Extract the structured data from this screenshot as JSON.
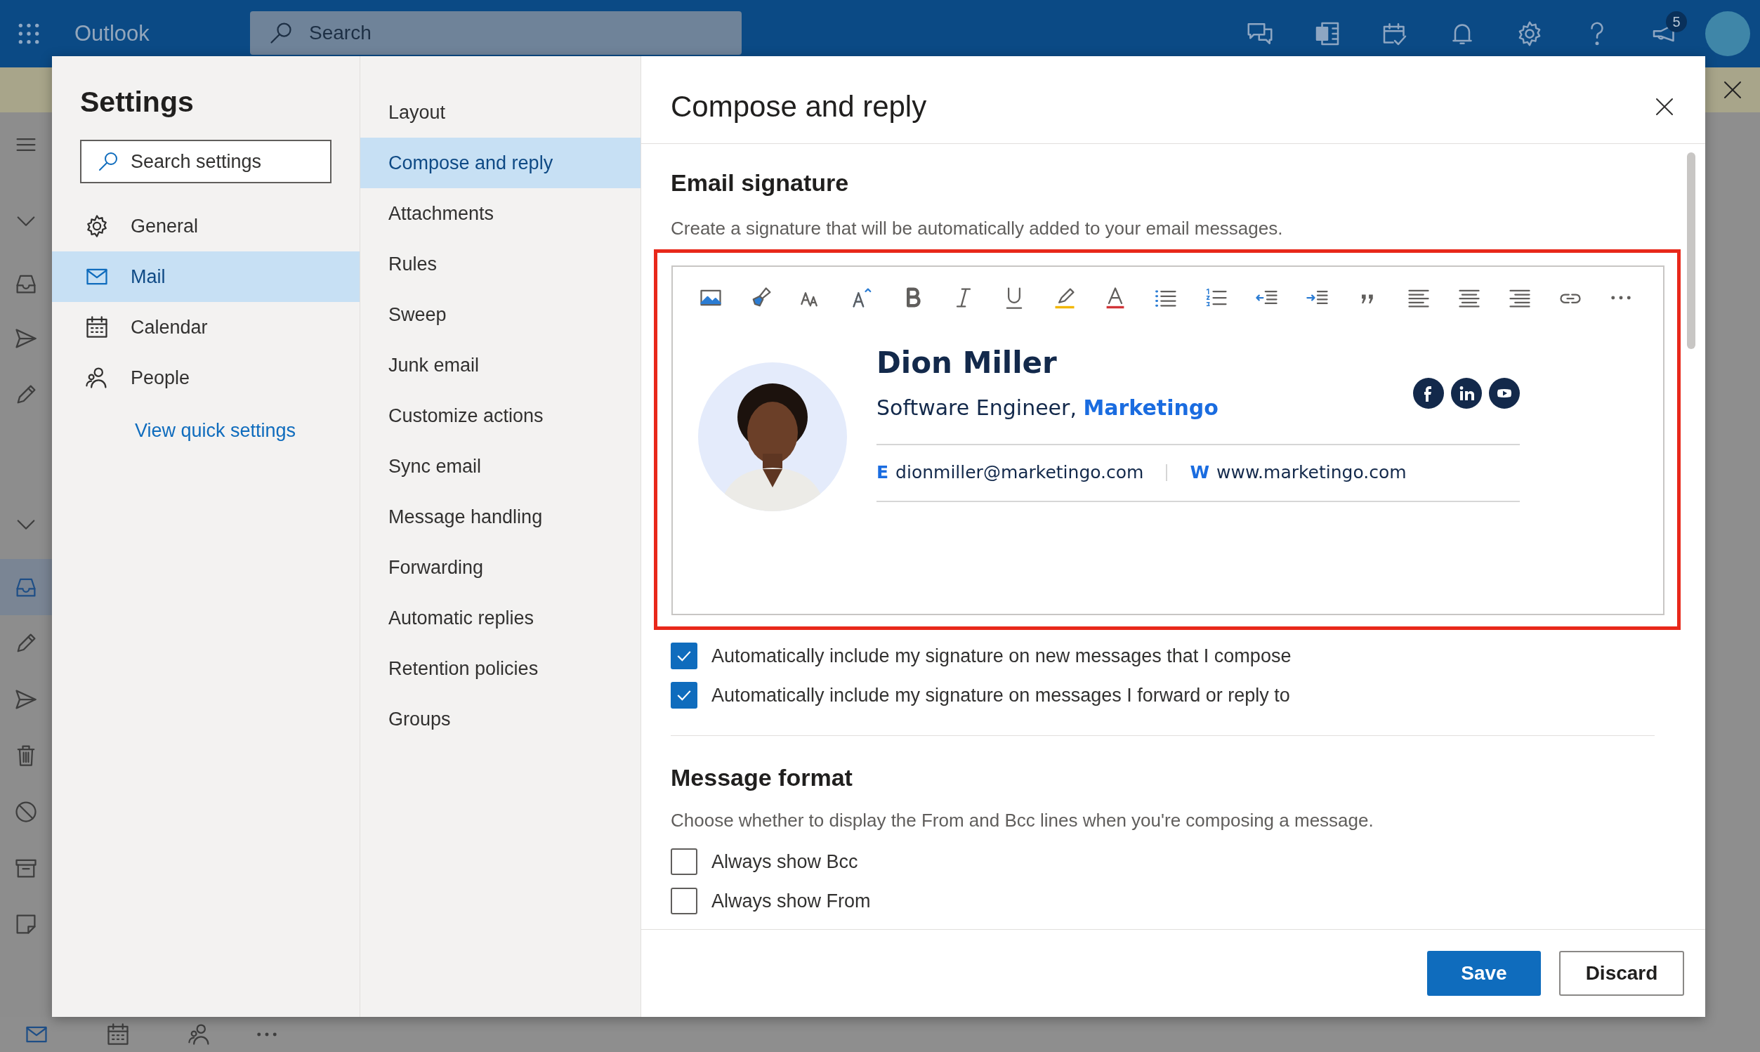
{
  "top_bar": {
    "app_name": "Outlook",
    "search": {
      "placeholder": "Search"
    },
    "notification_count": "5"
  },
  "nav_rail": [
    {
      "selected": false
    },
    {
      "selected": false
    },
    {
      "selected": false
    },
    {
      "selected": false
    },
    {
      "selected": false
    },
    {
      "selected": false
    },
    {
      "selected": true
    },
    {
      "selected": false
    },
    {
      "selected": false
    },
    {
      "selected": false
    },
    {
      "selected": false
    },
    {
      "selected": false
    },
    {
      "selected": false
    }
  ],
  "settings": {
    "title": "Settings",
    "search": {
      "placeholder": "Search settings"
    },
    "categories": [
      {
        "label": "General",
        "selected": false
      },
      {
        "label": "Mail",
        "selected": true
      },
      {
        "label": "Calendar",
        "selected": false
      },
      {
        "label": "People",
        "selected": false
      }
    ],
    "quick_settings_link": "View quick settings"
  },
  "subcategories": [
    {
      "label": "Layout",
      "selected": false
    },
    {
      "label": "Compose and reply",
      "selected": true
    },
    {
      "label": "Attachments",
      "selected": false
    },
    {
      "label": "Rules",
      "selected": false
    },
    {
      "label": "Sweep",
      "selected": false
    },
    {
      "label": "Junk email",
      "selected": false
    },
    {
      "label": "Customize actions",
      "selected": false
    },
    {
      "label": "Sync email",
      "selected": false
    },
    {
      "label": "Message handling",
      "selected": false
    },
    {
      "label": "Forwarding",
      "selected": false
    },
    {
      "label": "Automatic replies",
      "selected": false
    },
    {
      "label": "Retention policies",
      "selected": false
    },
    {
      "label": "Groups",
      "selected": false
    }
  ],
  "panel": {
    "title": "Compose and reply",
    "email_signature": {
      "heading": "Email signature",
      "description": "Create a signature that will be automatically added to your email messages.",
      "signature": {
        "name": "Dion Miller",
        "job_title": "Software Engineer,",
        "company": "Marketingo",
        "email_label": "E",
        "email": "dionmiller@marketingo.com",
        "web_label": "W",
        "website": "www.marketingo.com"
      },
      "options": [
        {
          "label": "Automatically include my signature on new messages that I compose",
          "checked": true
        },
        {
          "label": "Automatically include my signature on messages I forward or reply to",
          "checked": true
        }
      ]
    },
    "message_format": {
      "heading": "Message format",
      "description": "Choose whether to display the From and Bcc lines when you're composing a message.",
      "options": [
        {
          "label": "Always show Bcc",
          "checked": false
        },
        {
          "label": "Always show From",
          "checked": false
        }
      ]
    },
    "buttons": [
      {
        "label": "Save",
        "kind": "primary"
      },
      {
        "label": "Discard",
        "kind": "secondary"
      }
    ]
  }
}
